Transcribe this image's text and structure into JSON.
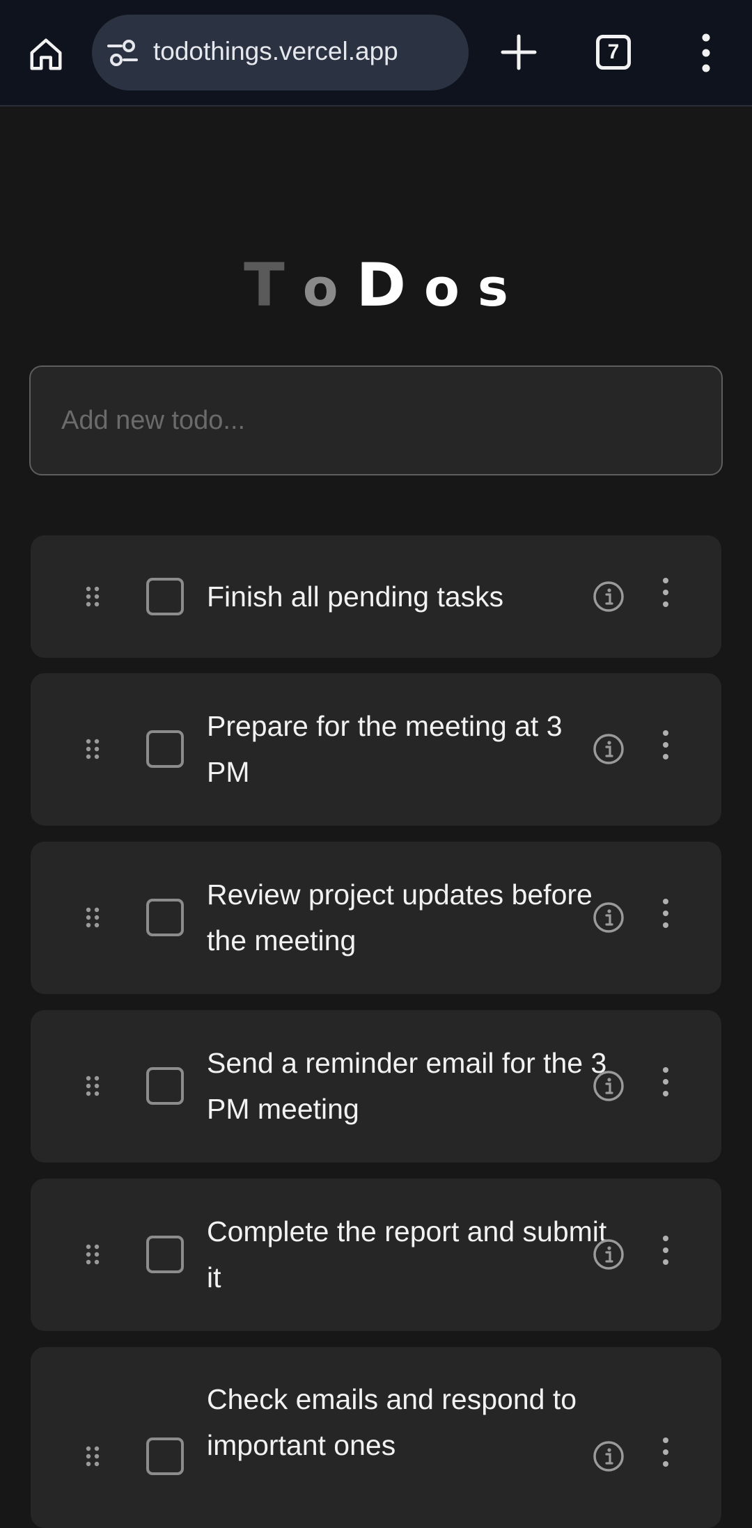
{
  "browser": {
    "url": "todothings.vercel.app",
    "tab_count": "7"
  },
  "app": {
    "title_letters": [
      "T",
      "o",
      "D",
      "o",
      "s"
    ]
  },
  "new_todo": {
    "placeholder": "Add new todo...",
    "value": ""
  },
  "todos": [
    {
      "text": "Finish all pending tasks",
      "checked": false
    },
    {
      "text": "Prepare for the meeting at 3 PM",
      "checked": false
    },
    {
      "text": "Review project updates before the meeting",
      "checked": false
    },
    {
      "text": "Send a reminder email for the 3 PM meeting",
      "checked": false
    },
    {
      "text": "Complete the report and submit it",
      "checked": false
    },
    {
      "text": "Check emails and respond to important ones",
      "checked": false
    }
  ],
  "icons": {
    "home": "home-icon",
    "site_settings": "tune-icon",
    "new_tab": "plus-icon",
    "tabs": "tab-switcher-icon",
    "menu": "more-vertical-icon",
    "drag": "drag-handle-icon",
    "info": "info-icon",
    "item_menu": "more-vertical-icon"
  },
  "colors": {
    "background": "#171717",
    "card": "#262626",
    "browser_bar": "#0f131d",
    "url_pill": "#2b3343"
  }
}
